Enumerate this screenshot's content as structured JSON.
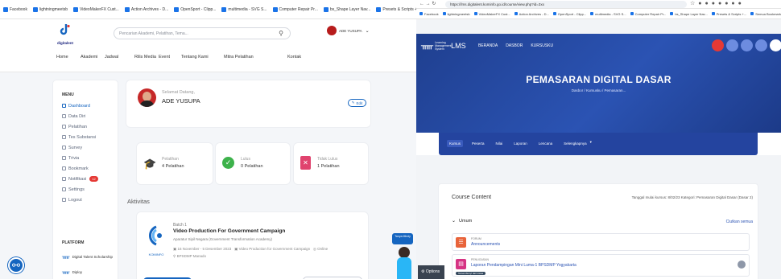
{
  "left": {
    "bookmarks": [
      "Facebook",
      "lightningmeetsb",
      "VideoMakerFX Cust...",
      "Action Archives - D...",
      "OpenSport - Clipp...",
      "multimedia - SVG S...",
      "Computer Repair Pr...",
      "bs_Shape Layer Nav...",
      "Presets & Scripts +...",
      "Semua Bookmark"
    ],
    "logo_text": "digitalent",
    "search_placeholder": "Pencarian Akademi, Pelatihan, Tema...",
    "user_name_top": "ADE YUSUPA",
    "nav": [
      "Home",
      "Akademi",
      "Jadwal",
      "Rilis Media",
      "Event",
      "Tentang Kami",
      "Mitra Pelatihan",
      "Kontak"
    ],
    "menu_title": "MENU",
    "menu": [
      "Dashboard",
      "Data Diri",
      "Pelatihan",
      "Tes Substansi",
      "Survey",
      "Trivia",
      "Bookmark",
      "Notifikasi",
      "Settings",
      "Logout"
    ],
    "notif_badge": "12",
    "platform_title": "PLATFORM",
    "platforms": [
      "Digital Talent Scholarship",
      "Diploy"
    ],
    "welcome": "Selamat Datang,",
    "user_name": "ADE YUSUPA",
    "edit_label": "Edit",
    "stats": [
      {
        "label": "Pelatihan",
        "value": "4 Pelatihan",
        "color": "#1e88e5"
      },
      {
        "label": "Lulus",
        "value": "0 Pelatihan",
        "color": "#3db24b"
      },
      {
        "label": "Tidak Lulus",
        "value": "1 Pelatihan",
        "color": "#e0436e"
      }
    ],
    "activity_title": "Aktivitas",
    "activity": {
      "batch": "Batch 1",
      "title": "Video Production For Government Campaign",
      "org": "Aparatur Sipil Negara (Government Transformation Academy)",
      "logo": "KOMINFO",
      "date": "16 November - 5 Desember 2023",
      "theme": "Video Production for Government Campaign",
      "mode": "Online",
      "location": "BPSDMP Manado"
    }
  },
  "right": {
    "url": "https://lms.digitalent.kominfo.go.id/course/view.php?id=3xx",
    "bookmarks": [
      "Facebook",
      "lightningmeetsb",
      "VideoMakerFX Cust...",
      "Action Archives - D...",
      "OpenSport - Clipp...",
      "multimedia - SVG S...",
      "Computer Repair Pr...",
      "bs_Shape Layer Nav...",
      "Presets & Scripts +...",
      "Semua Bookmark"
    ],
    "lms_brand_small": "Learning Management System",
    "lms_brand": "LMS",
    "nav": [
      "BERANDA",
      "DASBOR",
      "KURSUSKU"
    ],
    "course_title": "PEMASARAN DIGITAL DASAR",
    "breadcrumb": "Dasbor / Kursusku / Pemasaran...",
    "tabs": [
      "Kursus",
      "Peserta",
      "Nilai",
      "Laporan",
      "Lencana",
      "Selengkapnya"
    ],
    "content_title": "Course Content",
    "content_meta": "Tanggal mulai kursus: 8/02/23  Kategori: Pemasaran Digital Dasar (Dasar 2)",
    "section": "Umum",
    "collapse_all": "Ciutkan semua",
    "items": [
      {
        "type": "FORUM",
        "name": "Announcements",
        "color": "#e8633a"
      },
      {
        "type": "PENUGASAN",
        "name": "Laporan Pendampingan Mini Luma-1 BPSDMP Yogyakarta",
        "badge": "Tersembunyi dari siswa",
        "color": "#d63384"
      }
    ],
    "help": "Tanya Mindy",
    "options": "Options"
  }
}
